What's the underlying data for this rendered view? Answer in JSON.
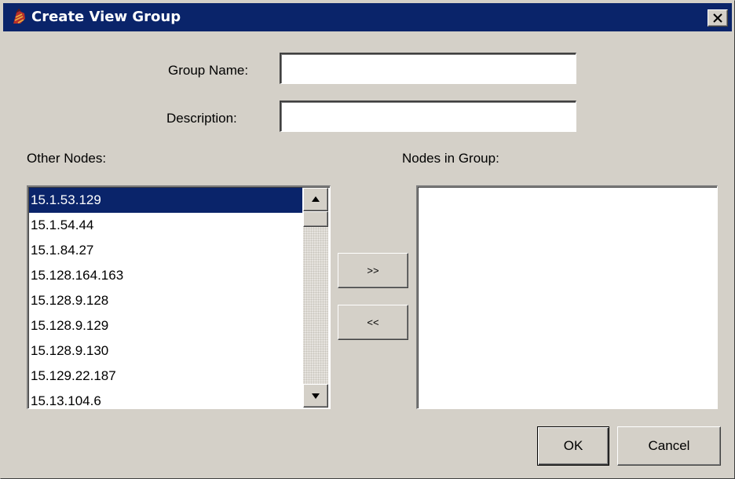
{
  "window": {
    "title": "Create View Group",
    "icon": "app-icon",
    "close_icon": "close-icon"
  },
  "form": {
    "group_name_label": "Group Name:",
    "group_name_value": "",
    "description_label": "Description:",
    "description_value": ""
  },
  "other_nodes": {
    "label": "Other Nodes:",
    "selected_index": 0,
    "items": [
      "15.1.53.129",
      "15.1.54.44",
      "15.1.84.27",
      "15.128.164.163",
      "15.128.9.128",
      "15.128.9.129",
      "15.128.9.130",
      "15.129.22.187",
      "15.13.104.6"
    ]
  },
  "nodes_in_group": {
    "label": "Nodes in Group:",
    "items": []
  },
  "buttons": {
    "add": ">>",
    "remove": "<<",
    "ok": "OK",
    "cancel": "Cancel"
  },
  "colors": {
    "titlebar": "#0a246a",
    "face": "#d4d0c8",
    "selection": "#0a246a"
  }
}
